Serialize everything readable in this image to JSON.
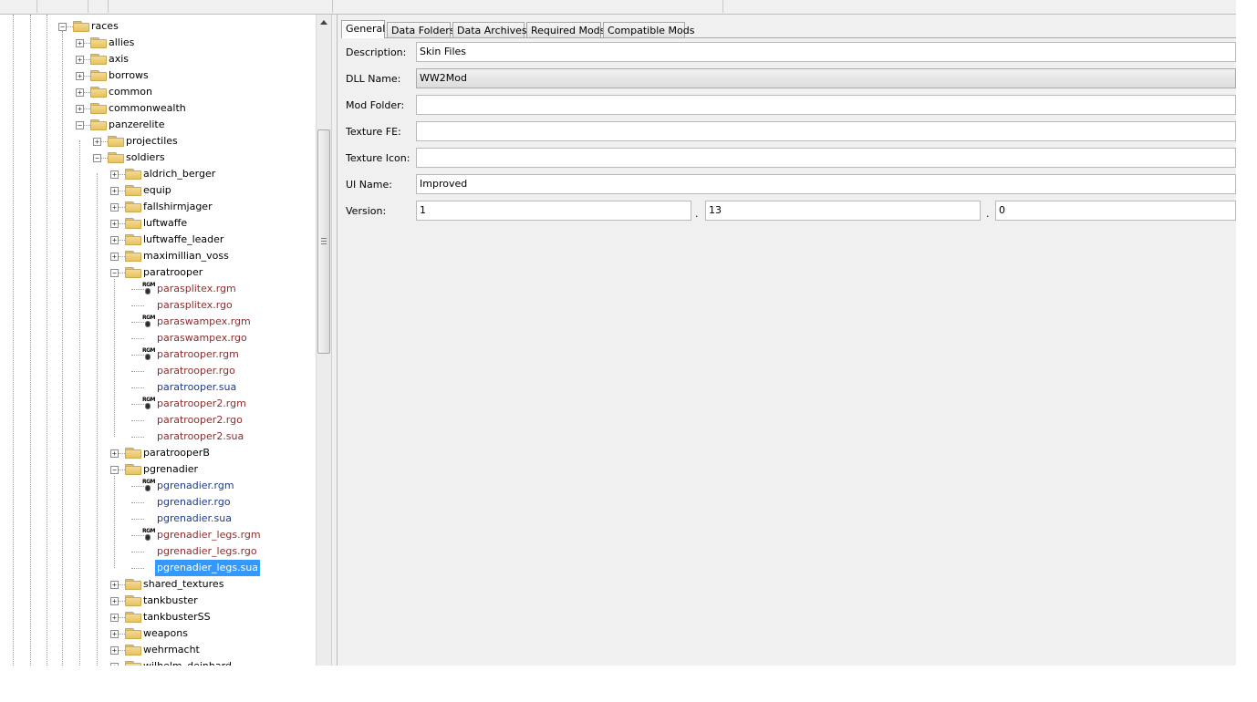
{
  "tree": {
    "nodes": [
      {
        "label": "races",
        "level": 0,
        "type": "folder",
        "state": "expanded",
        "color": "black"
      },
      {
        "label": "allies",
        "level": 1,
        "type": "folder",
        "state": "collapsed",
        "color": "black"
      },
      {
        "label": "axis",
        "level": 1,
        "type": "folder",
        "state": "collapsed",
        "color": "black"
      },
      {
        "label": "borrows",
        "level": 1,
        "type": "folder",
        "state": "collapsed",
        "color": "black"
      },
      {
        "label": "common",
        "level": 1,
        "type": "folder",
        "state": "collapsed",
        "color": "black"
      },
      {
        "label": "commonwealth",
        "level": 1,
        "type": "folder",
        "state": "collapsed",
        "color": "black"
      },
      {
        "label": "panzerelite",
        "level": 1,
        "type": "folder",
        "state": "expanded",
        "color": "black"
      },
      {
        "label": "projectiles",
        "level": 2,
        "type": "folder",
        "state": "collapsed",
        "color": "black"
      },
      {
        "label": "soldiers",
        "level": 2,
        "type": "folder",
        "state": "expanded",
        "color": "black"
      },
      {
        "label": "aldrich_berger",
        "level": 3,
        "type": "folder",
        "state": "collapsed",
        "color": "black"
      },
      {
        "label": "equip",
        "level": 3,
        "type": "folder",
        "state": "collapsed",
        "color": "black"
      },
      {
        "label": "fallshirmjager",
        "level": 3,
        "type": "folder",
        "state": "collapsed",
        "color": "black"
      },
      {
        "label": "luftwaffe",
        "level": 3,
        "type": "folder",
        "state": "collapsed",
        "color": "black"
      },
      {
        "label": "luftwaffe_leader",
        "level": 3,
        "type": "folder",
        "state": "collapsed",
        "color": "black"
      },
      {
        "label": "maximillian_voss",
        "level": 3,
        "type": "folder",
        "state": "collapsed",
        "color": "black"
      },
      {
        "label": "paratrooper",
        "level": 3,
        "type": "folder",
        "state": "expanded",
        "color": "black"
      },
      {
        "label": "parasplitex.rgm",
        "level": 4,
        "type": "rgm",
        "color": "red"
      },
      {
        "label": "parasplitex.rgo",
        "level": 4,
        "type": "file",
        "color": "red"
      },
      {
        "label": "paraswampex.rgm",
        "level": 4,
        "type": "rgm",
        "color": "red"
      },
      {
        "label": "paraswampex.rgo",
        "level": 4,
        "type": "file",
        "color": "red"
      },
      {
        "label": "paratrooper.rgm",
        "level": 4,
        "type": "rgm",
        "color": "red"
      },
      {
        "label": "paratrooper.rgo",
        "level": 4,
        "type": "file",
        "color": "red"
      },
      {
        "label": "paratrooper.sua",
        "level": 4,
        "type": "file",
        "color": "blue"
      },
      {
        "label": "paratrooper2.rgm",
        "level": 4,
        "type": "rgm",
        "color": "red"
      },
      {
        "label": "paratrooper2.rgo",
        "level": 4,
        "type": "file",
        "color": "red"
      },
      {
        "label": "paratrooper2.sua",
        "level": 4,
        "type": "file",
        "color": "red"
      },
      {
        "label": "paratrooperB",
        "level": 3,
        "type": "folder",
        "state": "collapsed",
        "color": "black"
      },
      {
        "label": "pgrenadier",
        "level": 3,
        "type": "folder",
        "state": "expanded",
        "color": "black"
      },
      {
        "label": "pgrenadier.rgm",
        "level": 4,
        "type": "rgm",
        "color": "blue"
      },
      {
        "label": "pgrenadier.rgo",
        "level": 4,
        "type": "file",
        "color": "blue"
      },
      {
        "label": "pgrenadier.sua",
        "level": 4,
        "type": "file",
        "color": "blue"
      },
      {
        "label": "pgrenadier_legs.rgm",
        "level": 4,
        "type": "rgm",
        "color": "red"
      },
      {
        "label": "pgrenadier_legs.rgo",
        "level": 4,
        "type": "file",
        "color": "red"
      },
      {
        "label": "pgrenadier_legs.sua",
        "level": 4,
        "type": "file",
        "color": "blue",
        "selected": true
      },
      {
        "label": "shared_textures",
        "level": 3,
        "type": "folder",
        "state": "collapsed",
        "color": "black"
      },
      {
        "label": "tankbuster",
        "level": 3,
        "type": "folder",
        "state": "collapsed",
        "color": "black"
      },
      {
        "label": "tankbusterSS",
        "level": 3,
        "type": "folder",
        "state": "collapsed",
        "color": "black"
      },
      {
        "label": "weapons",
        "level": 3,
        "type": "folder",
        "state": "collapsed",
        "color": "black"
      },
      {
        "label": "wehrmacht",
        "level": 3,
        "type": "folder",
        "state": "collapsed",
        "color": "black"
      },
      {
        "label": "wilhelm_deinhard",
        "level": 3,
        "type": "folder",
        "state": "collapsed",
        "color": "black"
      }
    ],
    "rgm_icon_text": "RGM"
  },
  "tabs": [
    {
      "label": "General",
      "active": true
    },
    {
      "label": "Data Folders",
      "active": false
    },
    {
      "label": "Data Archives",
      "active": false
    },
    {
      "label": "Required Mods",
      "active": false
    },
    {
      "label": "Compatible Mods",
      "active": false
    }
  ],
  "form": {
    "description_label": "Description:",
    "description_value": "Skin Files",
    "dll_name_label": "DLL Name:",
    "dll_name_value": "WW2Mod",
    "mod_folder_label": "Mod Folder:",
    "mod_folder_value": "",
    "texture_fe_label": "Texture FE:",
    "texture_fe_value": "",
    "texture_icon_label": "Texture Icon:",
    "texture_icon_value": "",
    "ui_name_label": "UI Name:",
    "ui_name_value": "Improved",
    "version_label": "Version:",
    "version_major": "1",
    "version_minor": "13",
    "version_patch": "0",
    "version_separator": "."
  },
  "colors": {
    "selection": "#3399ff",
    "file_red": "#8b2e2e",
    "file_blue": "#1f3c88"
  },
  "icons": {
    "expanded": "minus-box-icon",
    "collapsed": "plus-box-icon",
    "folder": "folder-icon",
    "rgm": "rgm-file-icon"
  }
}
